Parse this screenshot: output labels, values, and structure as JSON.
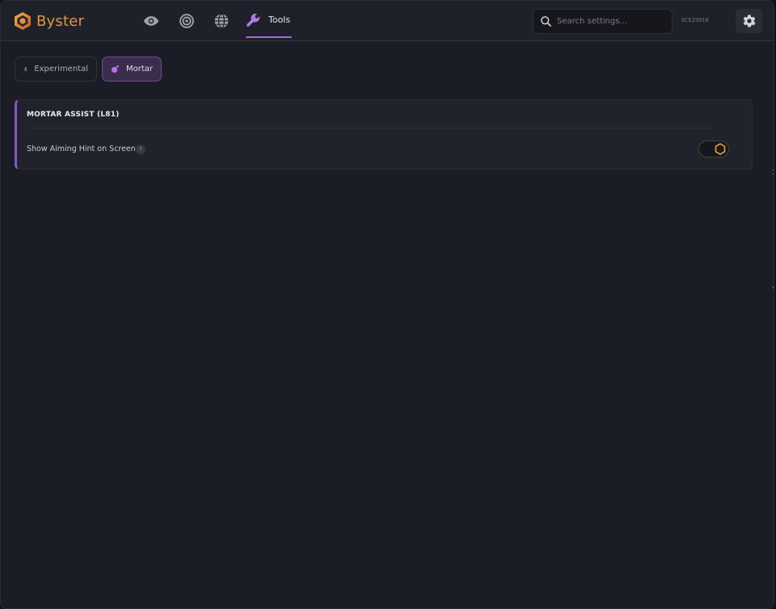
{
  "app": {
    "name": "Byster",
    "accent": "#e0963c",
    "highlight": "#a26bd9"
  },
  "nav": {
    "items": [
      {
        "icon": "eye-icon"
      },
      {
        "icon": "target-icon"
      },
      {
        "icon": "globe-icon"
      },
      {
        "icon": "wrench-icon",
        "label": "Tools",
        "active": true
      }
    ]
  },
  "search": {
    "placeholder": "Search settings..."
  },
  "hwid": "0CE29018",
  "subtabs": [
    {
      "label": "Experimental",
      "icon": "flask-icon",
      "active": false
    },
    {
      "label": "Mortar",
      "icon": "bomb-icon",
      "active": true
    }
  ],
  "section": {
    "title": "MORTAR ASSIST (L81)",
    "rows": [
      {
        "label": "Show Aiming Hint on Screen",
        "help": "?",
        "toggle_on": true
      }
    ]
  }
}
